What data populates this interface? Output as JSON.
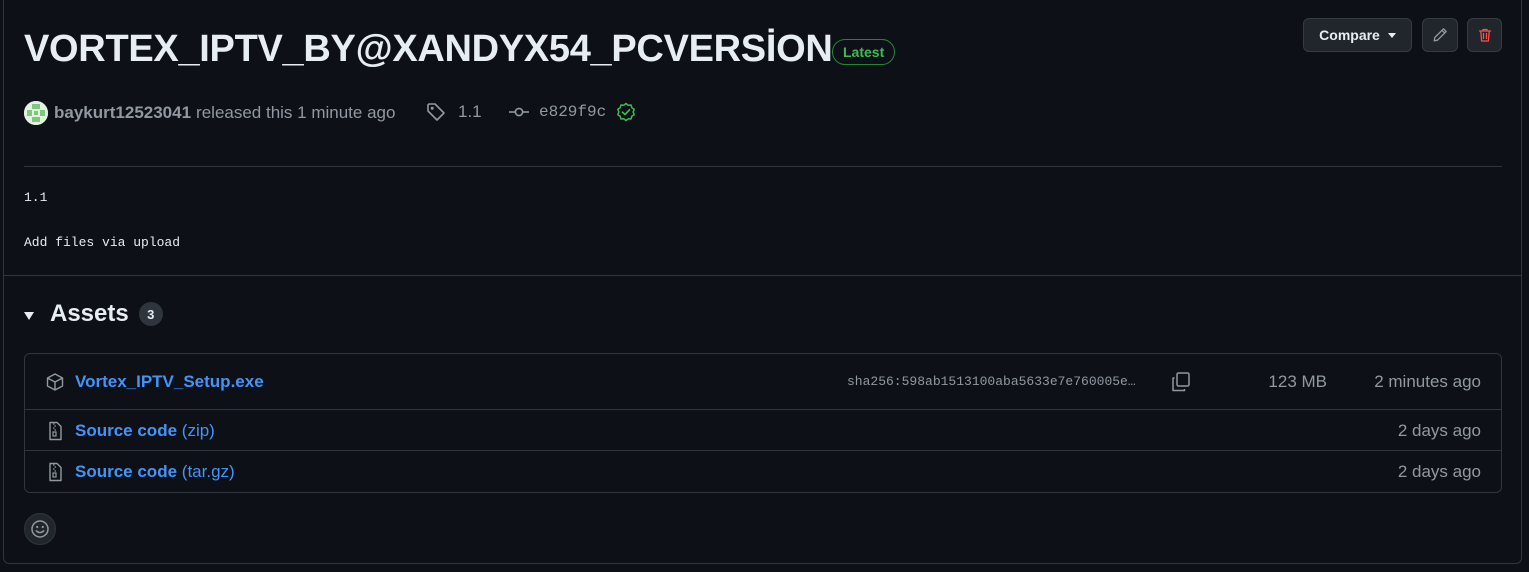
{
  "release": {
    "title": "VORTEX_IPTV_BY@XANDYX54_PCVERSİON",
    "latest_badge": "Latest",
    "author": "baykurt12523041",
    "released_text": "released this 1 minute ago",
    "tag": "1.1",
    "commit": "e829f9c",
    "verified": true
  },
  "actions": {
    "compare_label": "Compare",
    "edit_icon": "pencil-icon",
    "delete_icon": "trash-icon"
  },
  "notes": {
    "line1": "1.1",
    "line2": "Add files via upload"
  },
  "assets": {
    "heading": "Assets",
    "count": "3",
    "items": [
      {
        "name": "Vortex_IPTV_Setup.exe",
        "sha": "sha256:598ab1513100aba5633e7e760005e…",
        "size": "123 MB",
        "time": "2 minutes ago",
        "icon": "package-icon"
      },
      {
        "name": "Source code",
        "ext": "(zip)",
        "time": "2 days ago",
        "icon": "file-zip-icon"
      },
      {
        "name": "Source code",
        "ext": "(tar.gz)",
        "time": "2 days ago",
        "icon": "file-zip-icon"
      }
    ]
  },
  "colors": {
    "background": "#0d1117",
    "border": "#30363d",
    "link": "#4493f8",
    "success": "#3fb950",
    "danger": "#f85149",
    "muted": "#9198a1"
  }
}
